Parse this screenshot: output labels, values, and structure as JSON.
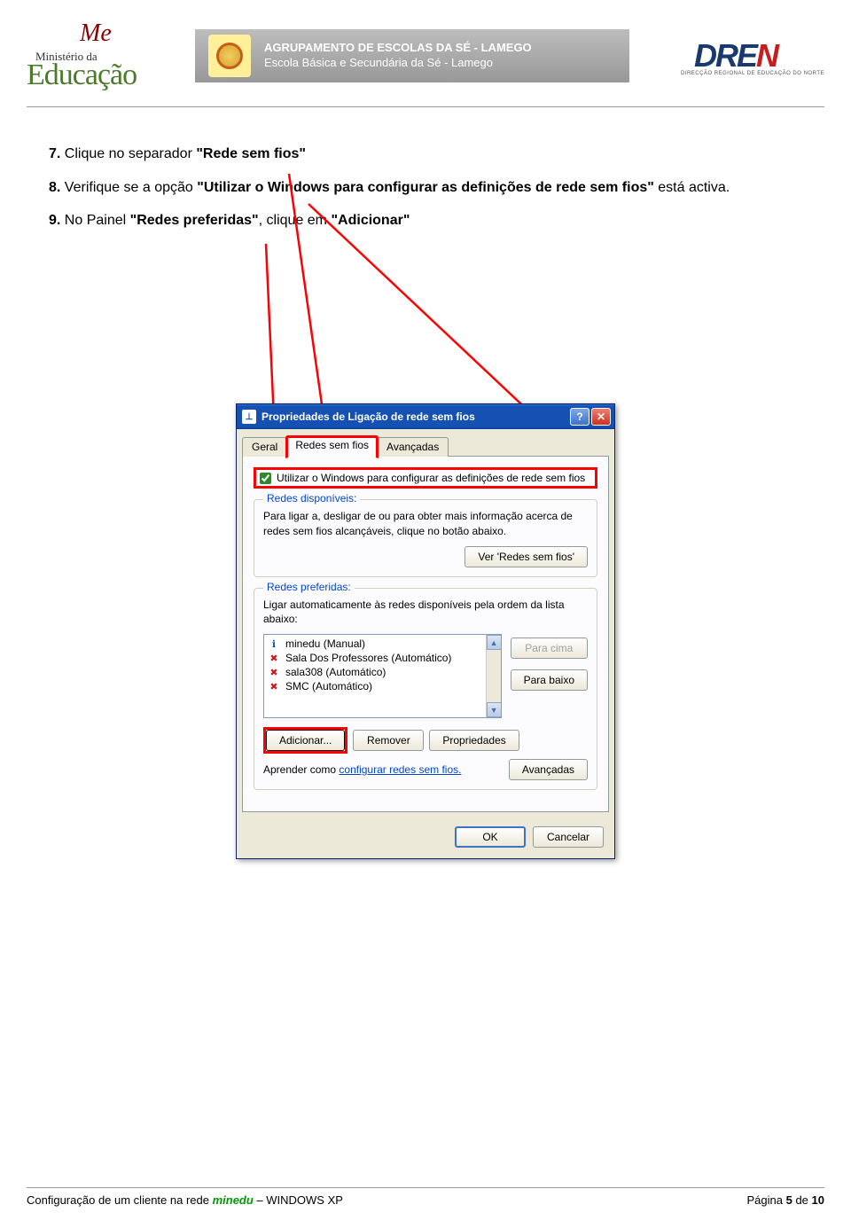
{
  "header": {
    "ministerio_top": "Me",
    "ministerio_mid": "Ministério da",
    "ministerio_bottom": "Educação",
    "banner_line1": "AGRUPAMENTO DE ESCOLAS DA SÉ - LAMEGO",
    "banner_line2": "Escola Básica e Secundária da Sé - Lamego",
    "dren": "DRE",
    "dren_n": "N",
    "dren_sub": "DIRECÇÃO REGIONAL DE EDUCAÇÃO DO NORTE"
  },
  "instructions": {
    "i7_num": "7.",
    "i7_a": "Clique no separador ",
    "i7_b": "\"Rede sem fios\"",
    "i8_num": "8.",
    "i8_a": "Verifique se a opção ",
    "i8_b": "\"Utilizar o Windows para configurar as definições de rede sem fios\"",
    "i8_c": " está activa.",
    "i9_num": "9.",
    "i9_a": "No Painel ",
    "i9_b": "\"Redes preferidas\"",
    "i9_c": ", clique em ",
    "i9_d": "\"Adicionar\""
  },
  "dialog": {
    "title": "Propriedades de Ligação de rede sem fios",
    "tabs": {
      "geral": "Geral",
      "redes": "Redes sem fios",
      "avancadas": "Avançadas"
    },
    "checkbox_label": "Utilizar o Windows para configurar as definições de rede sem fios",
    "group1_legend": "Redes disponíveis:",
    "group1_text": "Para ligar a, desligar de ou para obter mais informação acerca de redes sem fios alcançáveis, clique no botão abaixo.",
    "btn_ver": "Ver 'Redes sem fios'",
    "group2_legend": "Redes preferidas:",
    "group2_text": "Ligar automaticamente às redes disponíveis pela ordem da lista abaixo:",
    "networks": [
      {
        "icon": "ok",
        "label": "minedu (Manual)"
      },
      {
        "icon": "bad",
        "label": "Sala Dos Professores (Automático)"
      },
      {
        "icon": "bad",
        "label": "sala308 (Automático)"
      },
      {
        "icon": "bad",
        "label": "SMC (Automático)"
      }
    ],
    "btn_para_cima": "Para cima",
    "btn_para_baixo": "Para baixo",
    "btn_adicionar": "Adicionar...",
    "btn_remover": "Remover",
    "btn_propriedades": "Propriedades",
    "learn_prefix": "Aprender como ",
    "learn_link": "configurar redes sem fios.",
    "btn_avancadas": "Avançadas",
    "btn_ok": "OK",
    "btn_cancelar": "Cancelar"
  },
  "footer": {
    "left_a": "Configuração de um cliente na rede ",
    "left_b": "minedu",
    "left_c": " – WINDOWS XP",
    "right_a": "Página ",
    "right_b": "5",
    "right_c": " de ",
    "right_d": "10"
  }
}
